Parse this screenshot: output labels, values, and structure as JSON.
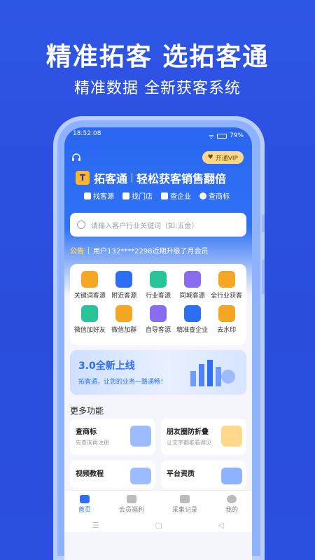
{
  "promo": {
    "title": "精准拓客 选拓客通",
    "subtitle": "精准数据 全新获客系统"
  },
  "status": {
    "time": "18:52:08",
    "signal": "ᯤ",
    "battery": "79%"
  },
  "header": {
    "vip_label": "开通VIP",
    "brand_name": "拓客通",
    "slogan": "轻松获客销售翻倍",
    "quick_links": [
      "找客源",
      "找门店",
      "查企业",
      "查商标"
    ]
  },
  "search": {
    "placeholder": "请输入客户行业关键词（如:五金）"
  },
  "notice": {
    "label": "公告",
    "text": "用户132****2298近期升级了月会员"
  },
  "grid": {
    "items": [
      {
        "label": "关键词客源",
        "color": "#f5a623"
      },
      {
        "label": "附近客源",
        "color": "#2d6ef7"
      },
      {
        "label": "行业客源",
        "color": "#27c49a"
      },
      {
        "label": "同城客源",
        "color": "#8a6cf0"
      },
      {
        "label": "全行业获客",
        "color": "#f5a623"
      },
      {
        "label": "微信加好友",
        "color": "#27c49a"
      },
      {
        "label": "微信加群",
        "color": "#f5a623"
      },
      {
        "label": "自导客源",
        "color": "#8a6cf0"
      },
      {
        "label": "精准查企业",
        "color": "#2d6ef7"
      },
      {
        "label": "去水印",
        "color": "#f5a623"
      }
    ]
  },
  "banner": {
    "title": "3.0全新上线",
    "subtitle": "拓客通，让您的业务一路通畅！"
  },
  "more": {
    "title": "更多功能",
    "features": [
      {
        "title": "查商标",
        "subtitle": "先查询再注册"
      },
      {
        "title": "朋友圈防折叠",
        "subtitle": "让文字都能看得见"
      },
      {
        "title": "视频教程",
        "subtitle": ""
      },
      {
        "title": "平台资质",
        "subtitle": ""
      }
    ]
  },
  "tabs": [
    "首页",
    "会员福利",
    "采集记录",
    "我的"
  ],
  "nav": {
    "menu": "☰",
    "home": "▢",
    "back": "◁"
  }
}
